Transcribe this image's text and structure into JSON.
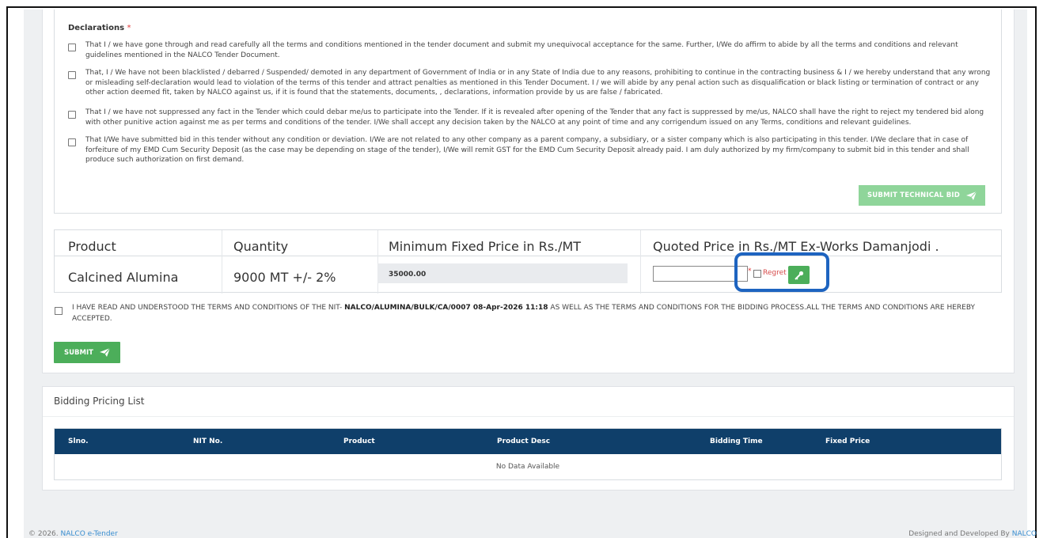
{
  "declarations": {
    "title": "Declarations",
    "required_mark": "*",
    "items": [
      {
        "text": "That I / we have gone through and read carefully all the terms and conditions mentioned in the tender document and submit my unequivocal acceptance for the same. Further, I/We do affirm to abide by all the terms and conditions and relevant guidelines mentioned in the NALCO Tender Document."
      },
      {
        "text": "That, I / We have not been blacklisted / debarred / Suspended/ demoted in any department of Government of India or in any State of India due to any reasons, prohibiting to continue in the contracting business & I / we hereby understand that any wrong or misleading self-declaration would lead to violation of the terms of this tender and attract penalties as mentioned in this Tender Document. I / we will abide by any penal action such as disqualification or black listing or termination of contract or any other action deemed fit, taken by NALCO against us, if it is found that the statements, documents, , declarations, information provide by us are false / fabricated."
      },
      {
        "text": "That I / we have not suppressed any fact in the Tender which could debar me/us to participate into the Tender. If it is revealed after opening of the Tender that any fact is suppressed by me/us, NALCO shall have the right to reject my tendered bid along with other punitive action against me as per terms and conditions of the tender. I/We shall accept any decision taken by the NALCO at any point of time and any corrigendum issued on any Terms, conditions and relevant guidelines."
      },
      {
        "text": "That I/We have submitted bid in this tender without any condition or deviation. I/We are not related to any other company as a parent company, a subsidiary, or a sister company which is also participating in this tender. I/We declare that in case of forfeiture of my EMD Cum Security Deposit (as the case may be depending on stage of the tender), I/We will remit GST for the EMD Cum Security Deposit already paid. I am duly authorized by my firm/company to submit bid in this tender and shall produce such authorization on first demand."
      }
    ],
    "submit_technical_label": "SUBMIT TECHNICAL BID"
  },
  "price_table": {
    "headers": [
      "Product",
      "Quantity",
      "Minimum Fixed Price in Rs./MT",
      "Quoted Price in Rs./MT Ex-Works Damanjodi ."
    ],
    "row": {
      "product": "Calcined Alumina",
      "quantity": "9000 MT +/- 2%",
      "min_price": "35000.00",
      "quoted_value": "",
      "required_mark": "*",
      "regret_label": "Regret"
    }
  },
  "agreement": {
    "prefix": "I HAVE READ AND UNDERSTOOD THE TERMS AND CONDITIONS OF THE NIT-",
    "nit_ref": "NALCO/ALUMINA/BULK/CA/0007 08-Apr-2026 11:18",
    "suffix": "AS WELL AS THE TERMS AND CONDITIONS FOR THE BIDDING PROCESS.ALL THE TERMS AND CONDITIONS ARE HEREBY ACCEPTED."
  },
  "submit_label": "SUBMIT",
  "bidding_list": {
    "title": "Bidding Pricing List",
    "headers": [
      "Slno.",
      "NIT No.",
      "Product",
      "Product Desc",
      "Bidding Time",
      "Fixed Price"
    ],
    "empty_text": "No Data Available"
  },
  "footer": {
    "copyright_prefix": "© 2026.",
    "site_name": "NALCO e-Tender",
    "credit_prefix": "Designed and Developed By",
    "credit_name": "NALCO"
  },
  "colors": {
    "accent_green": "#4cae5a",
    "disabled_green": "#8fd59a",
    "table_header_navy": "#0f3f6a",
    "highlight_blue": "#1e64c0",
    "link_blue": "#3a8ed0"
  }
}
